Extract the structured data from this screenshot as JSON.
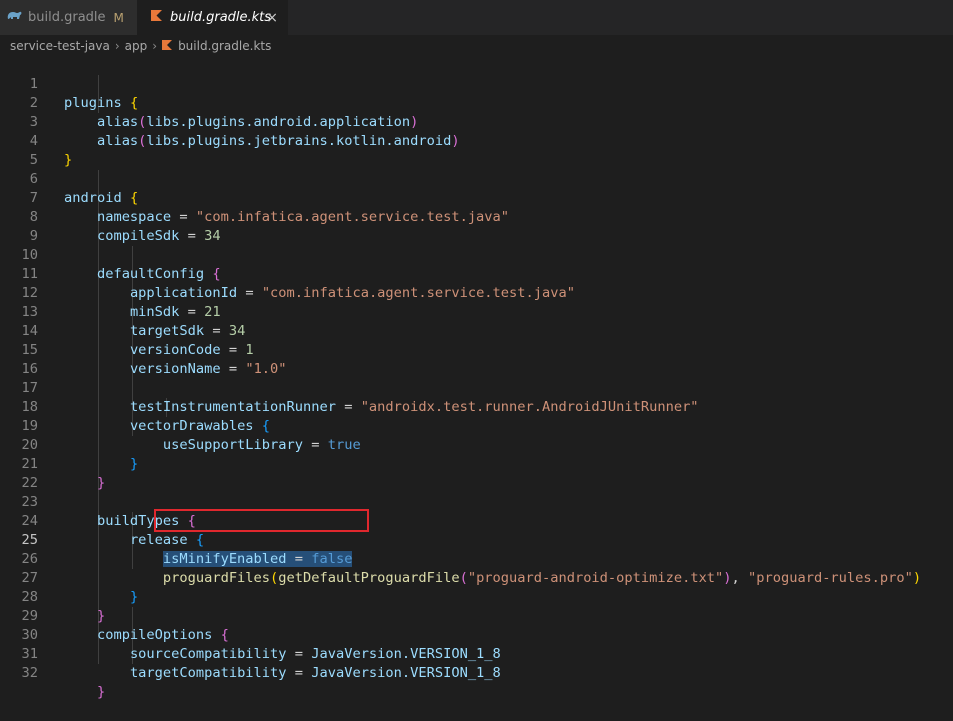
{
  "tabs": [
    {
      "label": "build.gradle",
      "badge": "M",
      "icon": "gradle-elephant-icon",
      "active": false
    },
    {
      "label": "build.gradle.kts",
      "icon": "kotlin-icon",
      "active": true,
      "close": "×"
    }
  ],
  "breadcrumb": {
    "items": [
      "service-test-java",
      "app",
      "build.gradle.kts"
    ],
    "separator": "›"
  },
  "editor": {
    "current_line": 25,
    "lines": [
      {
        "n": "1"
      },
      {
        "n": "2"
      },
      {
        "n": "3"
      },
      {
        "n": "4"
      },
      {
        "n": "5"
      },
      {
        "n": "6"
      },
      {
        "n": "7"
      },
      {
        "n": "8"
      },
      {
        "n": "9"
      },
      {
        "n": "10"
      },
      {
        "n": "11"
      },
      {
        "n": "12"
      },
      {
        "n": "13"
      },
      {
        "n": "14"
      },
      {
        "n": "15"
      },
      {
        "n": "16"
      },
      {
        "n": "17"
      },
      {
        "n": "18"
      },
      {
        "n": "19"
      },
      {
        "n": "20"
      },
      {
        "n": "21"
      },
      {
        "n": "22"
      },
      {
        "n": "23"
      },
      {
        "n": "24"
      },
      {
        "n": "25"
      },
      {
        "n": "26"
      },
      {
        "n": "27"
      },
      {
        "n": "28"
      },
      {
        "n": "29"
      },
      {
        "n": "30"
      },
      {
        "n": "31"
      },
      {
        "n": "32"
      }
    ],
    "code": {
      "plugins": "plugins",
      "alias": "alias",
      "alias1_arg": "libs.plugins.android.application",
      "alias2_arg": "libs.plugins.jetbrains.kotlin.android",
      "android": "android",
      "namespace_key": "namespace",
      "namespace_val": "\"com.infatica.agent.service.test.java\"",
      "compileSdk_key": "compileSdk",
      "compileSdk_val": "34",
      "defaultConfig": "defaultConfig",
      "applicationId_key": "applicationId",
      "applicationId_val": "\"com.infatica.agent.service.test.java\"",
      "minSdk_key": "minSdk",
      "minSdk_val": "21",
      "targetSdk_key": "targetSdk",
      "targetSdk_val": "34",
      "versionCode_key": "versionCode",
      "versionCode_val": "1",
      "versionName_key": "versionName",
      "versionName_val": "\"1.0\"",
      "runner_key": "testInstrumentationRunner",
      "runner_val": "\"androidx.test.runner.AndroidJUnitRunner\"",
      "vectorDrawables": "vectorDrawables",
      "useSupportLibrary_key": "useSupportLibrary",
      "useSupportLibrary_val": "true",
      "buildTypes": "buildTypes",
      "release": "release",
      "isMinifyEnabled_key": "isMinifyEnabled",
      "isMinifyEnabled_val": "false",
      "proguardFiles": "proguardFiles",
      "getDefaultProguardFile": "getDefaultProguardFile",
      "proguard_opt": "\"proguard-android-optimize.txt\"",
      "proguard_rules": "\"proguard-rules.pro\"",
      "compileOptions": "compileOptions",
      "sourceCompat_key": "sourceCompatibility",
      "targetCompat_key": "targetCompatibility",
      "java_version": "JavaVersion.VERSION_1_8"
    }
  },
  "colors": {
    "highlight_box": "#e0282e",
    "background": "#1e1e1e"
  }
}
